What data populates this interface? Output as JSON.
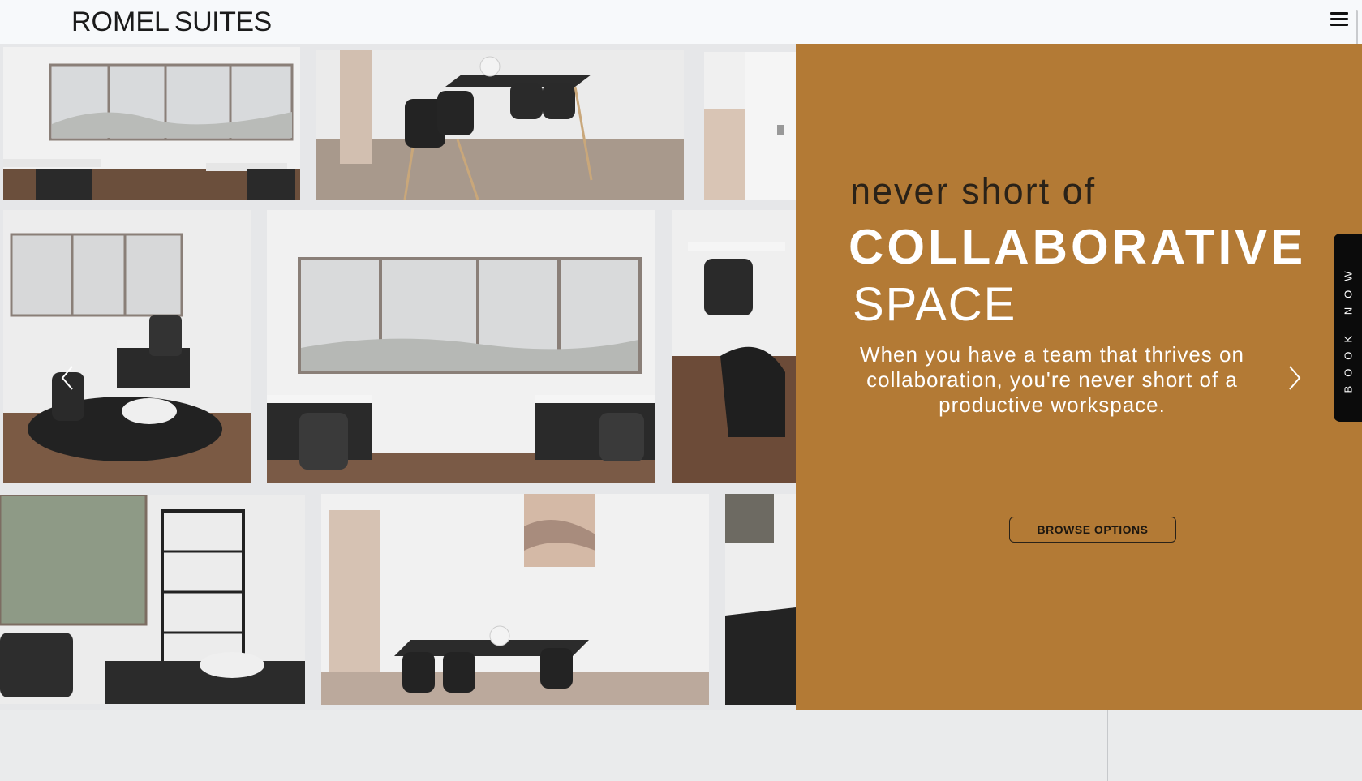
{
  "header": {
    "logo_part1": "ROMEL",
    "logo_part2": "SUITES",
    "menu_icon": "hamburger-menu-icon"
  },
  "hero": {
    "heading_line1": "never short of",
    "heading_line2": "COLLABORATIVE",
    "heading_line3": "SPACE",
    "description": "When you have a team that thrives on collaboration, you're never short of a productive workspace.",
    "browse_button": "BROWSE OPTIONS",
    "prev_icon": "chevron-left-icon",
    "next_icon": "chevron-right-icon"
  },
  "book_tab": {
    "label": "BOOK NOW"
  },
  "colors": {
    "promo_background": "#b37a35",
    "header_background": "#f7f9fb",
    "book_tab_background": "#0b0b0b"
  }
}
